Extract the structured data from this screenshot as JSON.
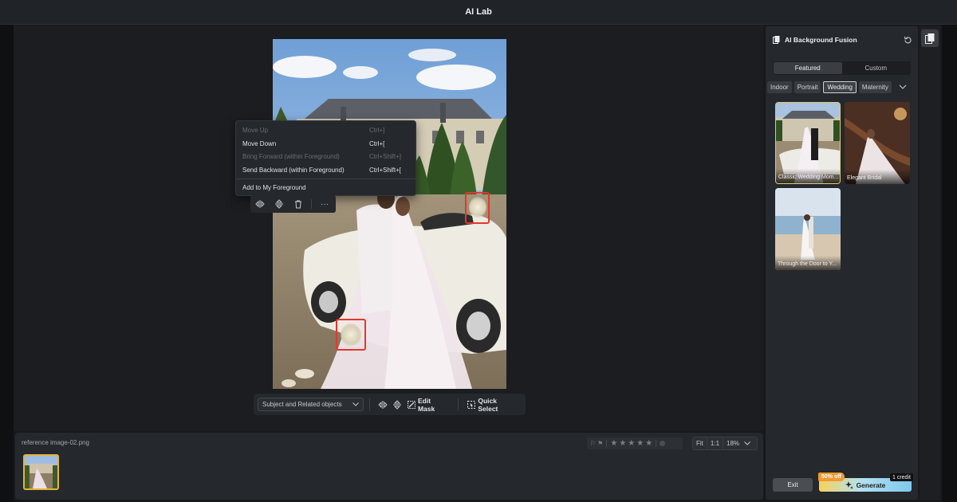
{
  "window": {
    "title": "AI Lab"
  },
  "context_menu": {
    "items": [
      {
        "label": "Move Up",
        "shortcut": "Ctrl+]",
        "enabled": false
      },
      {
        "label": "Move Down",
        "shortcut": "Ctrl+[",
        "enabled": true
      },
      {
        "label": "Bring Forward (within Foreground)",
        "shortcut": "Ctrl+Shift+]",
        "enabled": false
      },
      {
        "label": "Send Backward (within Foreground)",
        "shortcut": "Ctrl+Shift+[",
        "enabled": true
      },
      {
        "label": "Add to My Foreground",
        "shortcut": "",
        "enabled": true
      }
    ]
  },
  "mini_toolbar": {
    "more": "···"
  },
  "selection_toolbar": {
    "dropdown_value": "Subject and Related objects",
    "edit_mask": "Edit Mask",
    "quick_select": "Quick Select"
  },
  "filmstrip": {
    "filename": "reference image-02.png"
  },
  "zoom": {
    "fit": "Fit",
    "one_to_one": "1:1",
    "level": "18%"
  },
  "right_panel": {
    "title": "AI Background Fusion",
    "tabs": [
      "Featured",
      "Custom"
    ],
    "active_tab": "Featured",
    "categories": [
      "Indoor",
      "Portrait",
      "Wedding",
      "Maternity"
    ],
    "active_category": "Wedding",
    "presets": [
      {
        "label": "Classic Wedding Mom...",
        "selected": true
      },
      {
        "label": "Elegant Bridal",
        "selected": false
      },
      {
        "label": "Through the Door to Y...",
        "selected": false
      }
    ],
    "exit_label": "Exit",
    "generate_label": "Generate",
    "discount_tag": "50% off",
    "credit_tag": "1 credit"
  },
  "colors": {
    "accent_gold": "#e3b43b",
    "mask_red": "#e0392c",
    "off_orange": "#f29a2e"
  }
}
